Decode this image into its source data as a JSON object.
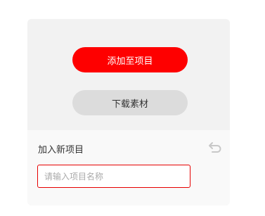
{
  "panel": {
    "add_to_project_label": "添加至项目",
    "download_label": "下载素材"
  },
  "new_project": {
    "title": "加入新项目",
    "input_value": "",
    "input_placeholder": "请输入项目名称",
    "undo_icon": "undo-icon"
  },
  "colors": {
    "primary": "#fe0000",
    "secondary_button": "#dcdcdc",
    "input_border": "#e60000"
  }
}
